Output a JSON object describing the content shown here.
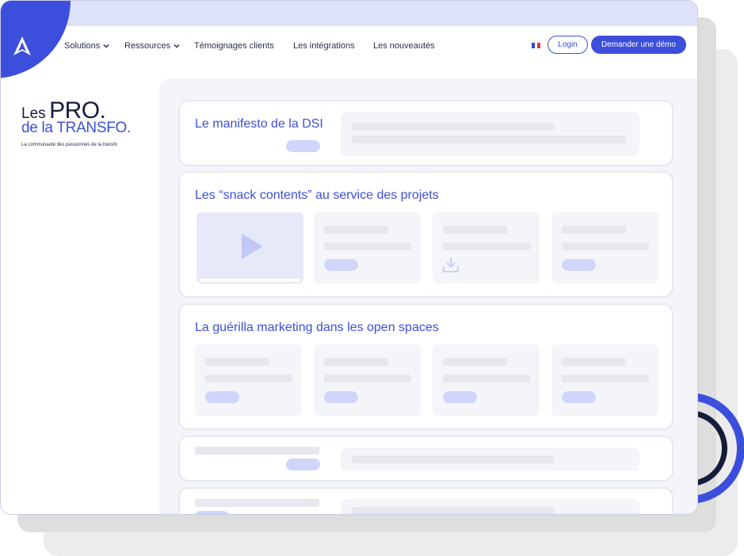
{
  "nav": {
    "items": [
      "Solutions",
      "Ressources",
      "Témoignages clients",
      "Les intégrations",
      "Les nouveautés"
    ],
    "login": "Login",
    "demo": "Demander une démo",
    "flag_colors": [
      "#2d4ad8",
      "#ffffff",
      "#e4353a"
    ]
  },
  "brand": {
    "les": "Les",
    "pro": "PRO.",
    "line2": "de la TRANSFO.",
    "tagline": "La communauté des passionnés de la transfo"
  },
  "cards": [
    {
      "title": "Le manifesto de la DSI"
    },
    {
      "title": "Les “snack contents” au service des projets"
    },
    {
      "title": "La guérilla marketing dans les open spaces"
    }
  ],
  "icons": {
    "logo": "arrow-logo-icon",
    "chevron": "chevron-down-icon",
    "play": "play-icon",
    "download": "download-icon"
  },
  "colors": {
    "accent": "#3c4fdc",
    "navy": "#151d3b",
    "titlebar": "#dfe3fa",
    "placeholder_bar": "#e6e8ee",
    "placeholder_pill": "#cfd5fb"
  }
}
